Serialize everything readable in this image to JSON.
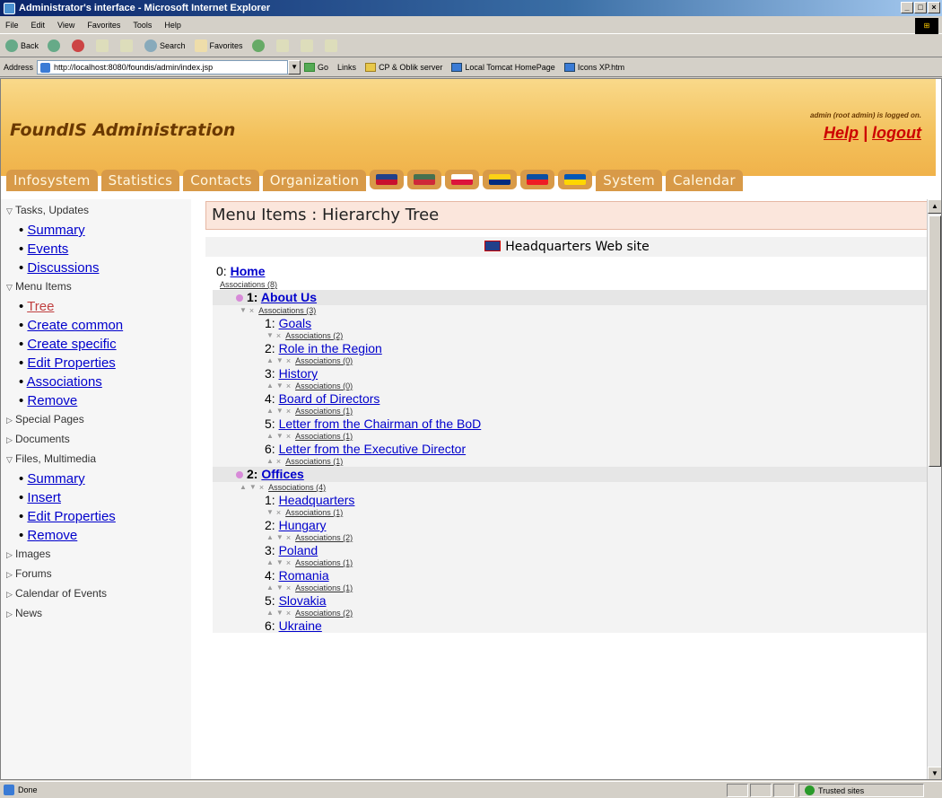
{
  "window": {
    "title": "Administrator's interface - Microsoft Internet Explorer"
  },
  "menubar": [
    "File",
    "Edit",
    "View",
    "Favorites",
    "Tools",
    "Help"
  ],
  "toolbar": {
    "back": "Back",
    "search": "Search",
    "favorites": "Favorites"
  },
  "address": {
    "label": "Address",
    "url": "http://localhost:8080/foundis/admin/index.jsp",
    "go": "Go",
    "links_label": "Links",
    "links": [
      "CP & Oblik server",
      "Local Tomcat HomePage",
      "Icons XP.htm"
    ]
  },
  "header": {
    "title": "FoundIS Administration",
    "login": "admin (root admin) is logged on.",
    "help": "Help",
    "sep": " | ",
    "logout": "logout"
  },
  "tabs": [
    "Infosystem",
    "Statistics",
    "Contacts",
    "Organization",
    "System",
    "Calendar"
  ],
  "flags": [
    {
      "icon": "uk-flag-icon",
      "bg": "#22408a",
      "stripe": "#c8102e"
    },
    {
      "icon": "hungary-flag-icon",
      "bg": "#477050",
      "stripe": "#ce2939"
    },
    {
      "icon": "poland-flag-icon",
      "bg": "#ffffff",
      "stripe": "#dc143c"
    },
    {
      "icon": "romania-flag-icon",
      "bg": "#fcd116",
      "stripe": "#002b7f"
    },
    {
      "icon": "slovakia-flag-icon",
      "bg": "#0b4ea2",
      "stripe": "#ee1c25"
    },
    {
      "icon": "ukraine-flag-icon",
      "bg": "#0057b7",
      "stripe": "#ffd700"
    }
  ],
  "sidebar": [
    {
      "label": "Tasks, Updates",
      "open": true,
      "items": [
        "Summary",
        "Events",
        "Discussions"
      ]
    },
    {
      "label": "Menu Items",
      "open": true,
      "items": [
        "Tree",
        "Create common",
        "Create specific",
        "Edit Properties",
        "Associations",
        "Remove"
      ],
      "active": "Tree"
    },
    {
      "label": "Special Pages",
      "open": false,
      "items": []
    },
    {
      "label": "Documents",
      "open": false,
      "items": []
    },
    {
      "label": "Files, Multimedia",
      "open": true,
      "items": [
        "Summary",
        "Insert",
        "Edit Properties",
        "Remove"
      ]
    },
    {
      "label": "Images",
      "open": false,
      "items": []
    },
    {
      "label": "Forums",
      "open": false,
      "items": []
    },
    {
      "label": "Calendar of Events",
      "open": false,
      "items": []
    },
    {
      "label": "News",
      "open": false,
      "items": []
    }
  ],
  "main": {
    "heading": "Menu Items  :  Hierarchy Tree",
    "site": "Headquarters Web site",
    "root": {
      "prefix": "0: ",
      "label": "Home",
      "assoc": "Associations (8)"
    },
    "nodes": [
      {
        "prefix": "1: ",
        "label": "About Us",
        "assoc": "Associations (3)",
        "up": false,
        "down": true,
        "children": [
          {
            "prefix": "1: ",
            "label": "Goals",
            "assoc": "Associations (2)",
            "up": false,
            "down": true
          },
          {
            "prefix": "2: ",
            "label": "Role in the Region",
            "assoc": "Associations (0)",
            "up": true,
            "down": true
          },
          {
            "prefix": "3: ",
            "label": "History",
            "assoc": "Associations (0)",
            "up": true,
            "down": true
          },
          {
            "prefix": "4: ",
            "label": "Board of Directors",
            "assoc": "Associations (1)",
            "up": true,
            "down": true
          },
          {
            "prefix": "5: ",
            "label": "Letter from the Chairman of the BoD",
            "assoc": "Associations (1)",
            "up": true,
            "down": true
          },
          {
            "prefix": "6: ",
            "label": "Letter from the Executive Director",
            "assoc": "Associations (1)",
            "up": true,
            "down": false
          }
        ]
      },
      {
        "prefix": "2: ",
        "label": "Offices",
        "assoc": "Associations (4)",
        "up": true,
        "down": true,
        "children": [
          {
            "prefix": "1: ",
            "label": "Headquarters",
            "assoc": "Associations (1)",
            "up": false,
            "down": true
          },
          {
            "prefix": "2: ",
            "label": "Hungary",
            "assoc": "Associations (2)",
            "up": true,
            "down": true
          },
          {
            "prefix": "3: ",
            "label": "Poland",
            "assoc": "Associations (1)",
            "up": true,
            "down": true
          },
          {
            "prefix": "4: ",
            "label": "Romania",
            "assoc": "Associations (1)",
            "up": true,
            "down": true
          },
          {
            "prefix": "5: ",
            "label": "Slovakia",
            "assoc": "Associations (2)",
            "up": true,
            "down": true
          },
          {
            "prefix": "6: ",
            "label": "Ukraine",
            "assoc": "",
            "up": false,
            "down": false
          }
        ]
      }
    ]
  },
  "status": {
    "text": "Done",
    "zone": "Trusted sites"
  },
  "colors": {
    "accent": "#d89a48",
    "link": "#0000cc",
    "active_link": "#c04040",
    "header_title": "#6a3800",
    "help": "#cc0000"
  }
}
